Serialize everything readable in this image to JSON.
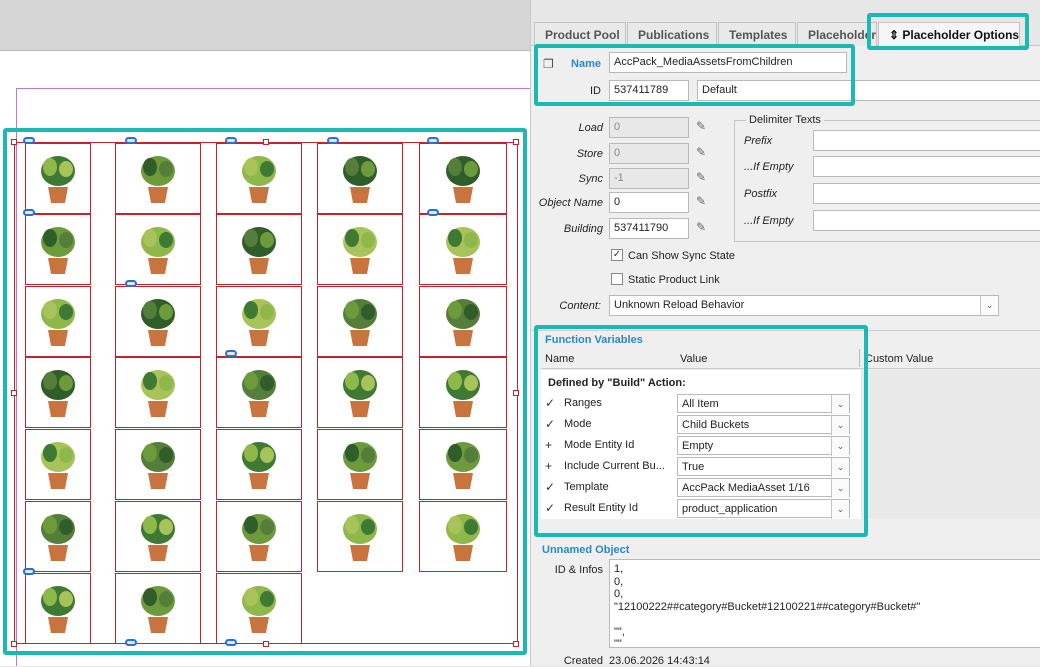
{
  "tabs": [
    {
      "label": "Product Pool",
      "active": false
    },
    {
      "label": "Publications",
      "active": false
    },
    {
      "label": "Templates",
      "active": false
    },
    {
      "label": "Placeholder",
      "active": false
    },
    {
      "label": "Placeholder Options",
      "active": true
    }
  ],
  "active_tab_icon": "⇕",
  "name_section": {
    "name_label": "Name",
    "name_value": "AccPack_MediaAssetsFromChildren",
    "id_label": "ID",
    "id_value": "537411789",
    "id_default": "Default"
  },
  "properties": {
    "load_label": "Load",
    "load_value": "0",
    "store_label": "Store",
    "store_value": "0",
    "sync_label": "Sync",
    "sync_value": "-1",
    "object_name_label": "Object Name",
    "object_name_value": "0",
    "building_label": "Building",
    "building_value": "537411790"
  },
  "delimiter": {
    "title": "Delimiter Texts",
    "prefix_label": "Prefix",
    "if_empty_label": "...If Empty",
    "postfix_label": "Postfix",
    "if_empty2_label": "...If Empty"
  },
  "checkboxes": {
    "can_show_sync_label": "Can Show Sync State",
    "can_show_sync_checked": true,
    "static_link_label": "Static Product Link",
    "static_link_checked": false
  },
  "content": {
    "label": "Content:",
    "value": "Unknown Reload Behavior"
  },
  "function_variables": {
    "title": "Function Variables",
    "col_name": "Name",
    "col_value": "Value",
    "col_custom": "Custom Value",
    "group_title": "Defined by \"Build\" Action:",
    "rows": [
      {
        "icon": "✓",
        "name": "Ranges",
        "value": "All Item"
      },
      {
        "icon": "✓",
        "name": "Mode",
        "value": "Child Buckets"
      },
      {
        "icon": "+",
        "name": "Mode Entity Id",
        "value": "Empty"
      },
      {
        "icon": "+",
        "name": "Include Current Bu...",
        "value": "True"
      },
      {
        "icon": "✓",
        "name": "Template",
        "value": "AccPack MediaAsset 1/16"
      },
      {
        "icon": "✓",
        "name": "Result Entity Id",
        "value": "product_application"
      }
    ]
  },
  "unnamed": {
    "title": "Unnamed Object",
    "id_infos_label": "ID & Infos",
    "id_infos_value": "1,\n0,\n0,\n\"12100222##category#Bucket#12100221##category#Bucket#\"\n\n\"\",\n\"\"",
    "created_label": "Created",
    "created_value": "23.06.2026 14:43:14"
  },
  "colors": {
    "highlight": "#1bb9b4",
    "frame_red": "#c9202a",
    "accent_blue": "#2a88c7"
  }
}
